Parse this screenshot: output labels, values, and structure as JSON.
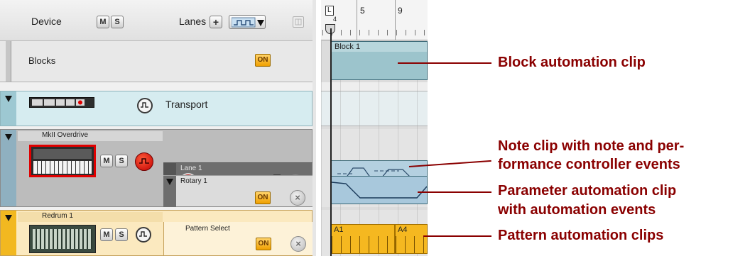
{
  "header": {
    "device_label": "Device",
    "lanes_label": "Lanes",
    "mute_label": "M",
    "solo_label": "S",
    "add_lane_label": "+"
  },
  "blocks_track": {
    "name": "Blocks",
    "on_label": "ON"
  },
  "transport_track": {
    "name": "Transport"
  },
  "mkii_track": {
    "name": "MkII Overdrive",
    "lane_name": "Lane 1",
    "param_name": "Rotary 1",
    "on_label": "ON"
  },
  "redrum_track": {
    "name": "Redrum 1",
    "param_name": "Pattern Select",
    "on_label": "ON"
  },
  "ruler": {
    "loop_marker": "L",
    "marker_small": "4",
    "bar_5": "5",
    "bar_9": "9"
  },
  "clips": {
    "block_clip_label": "Block 1",
    "pattern_a1": "A1",
    "pattern_a4": "A4"
  },
  "annotations": {
    "block": "Block automation clip",
    "note_line1": "Note clip with note and per-",
    "note_line2": "formance controller events",
    "param_line1": "Parameter automation clip",
    "param_line2": "with automation events",
    "pattern": "Pattern automation clips"
  },
  "colors": {
    "accent_annotation": "#8a0000",
    "on_button": "#f0a000",
    "block_clip": "#9cc4cc",
    "pattern_clip": "#f5b820",
    "transport_row": "#d6ecf0",
    "redrum_row": "#fbe9bf"
  }
}
